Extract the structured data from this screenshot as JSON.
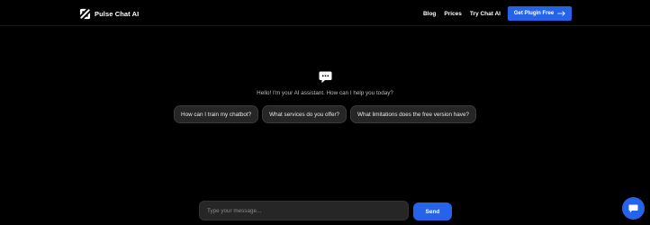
{
  "header": {
    "brand": "Pulse Chat AI",
    "nav": {
      "blog": "Blog",
      "prices": "Prices",
      "try": "Try Chat AI"
    },
    "cta": {
      "label": "Get Plugin Free",
      "icon": "arrow-right-icon"
    }
  },
  "hero": {
    "icon": "chat-bubble-icon",
    "greeting": "Hello! I'm your AI assistant. How can I help you today?",
    "suggestions": [
      "How can I train my chatbot?",
      "What services do you offer?",
      "What limitations does the free version have?"
    ]
  },
  "composer": {
    "placeholder": "Type your message...",
    "send_label": "Send"
  },
  "widget": {
    "icon": "chat-widget-icon"
  },
  "colors": {
    "background": "#000000",
    "accent": "#2563eb",
    "chip_bg": "#262626"
  }
}
